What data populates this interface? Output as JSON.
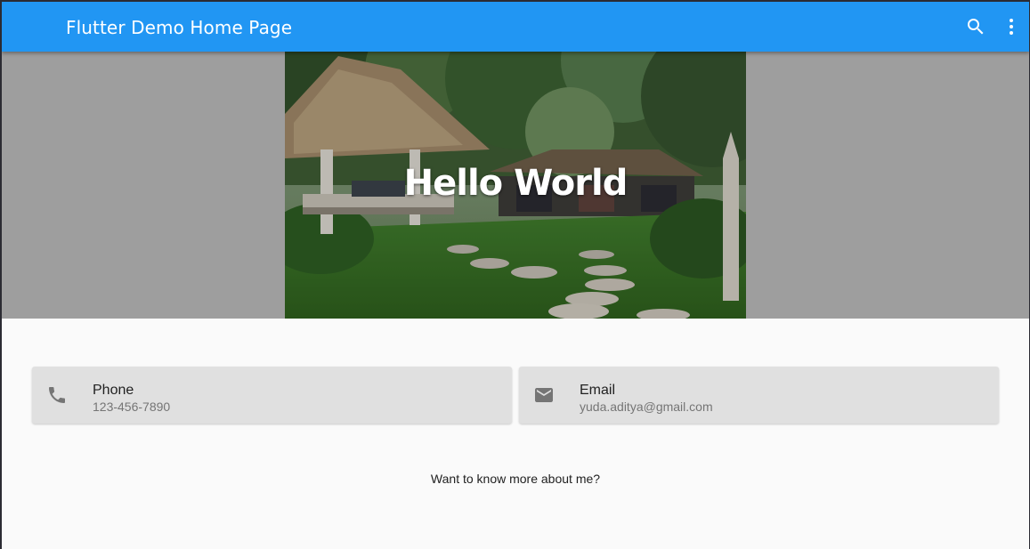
{
  "app_bar": {
    "title": "Flutter Demo Home Page",
    "color": "#2196f3",
    "actions": [
      {
        "icon": "search-icon"
      },
      {
        "icon": "more-vert-icon"
      }
    ]
  },
  "hero": {
    "title": "Hello World",
    "image": "garden-gazebo-photo",
    "backdrop_color": "#9e9e9e"
  },
  "contacts": {
    "phone": {
      "icon": "phone-icon",
      "label": "Phone",
      "value": "123-456-7890"
    },
    "email": {
      "icon": "email-icon",
      "label": "Email",
      "value": "yuda.aditya@gmail.com"
    }
  },
  "footer": {
    "more_text": "Want to know more about me?"
  }
}
